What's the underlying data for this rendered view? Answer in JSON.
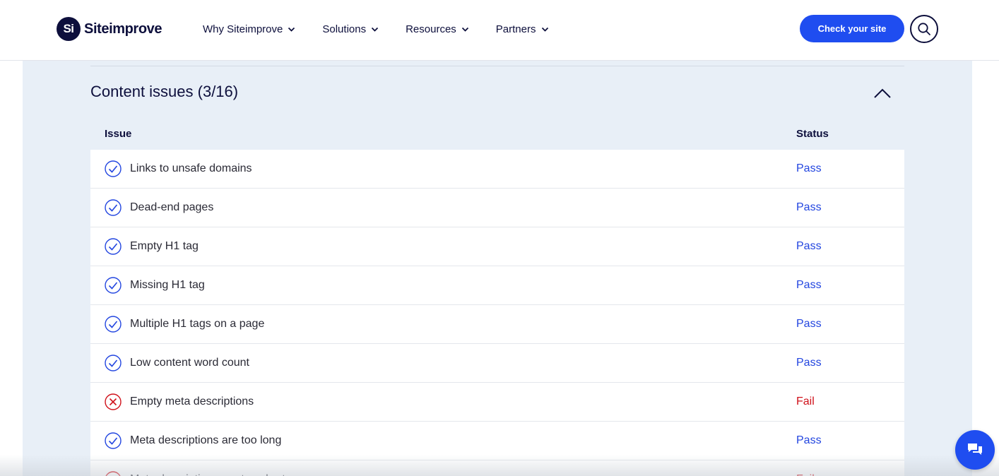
{
  "header": {
    "logo_mark": "Si",
    "logo_text": "Siteimprove",
    "nav": [
      {
        "label": "Why Siteimprove"
      },
      {
        "label": "Solutions"
      },
      {
        "label": "Resources"
      },
      {
        "label": "Partners"
      }
    ],
    "cta_label": "Check your site",
    "search_icon": "search-icon"
  },
  "section": {
    "title": "Content issues (3/16)",
    "collapse_icon": "chevron-up-icon",
    "columns": {
      "issue": "Issue",
      "status": "Status"
    },
    "rows": [
      {
        "issue": "Links to unsafe domains",
        "status": "Pass",
        "result": "pass"
      },
      {
        "issue": "Dead-end pages",
        "status": "Pass",
        "result": "pass"
      },
      {
        "issue": "Empty H1 tag",
        "status": "Pass",
        "result": "pass"
      },
      {
        "issue": "Missing H1 tag",
        "status": "Pass",
        "result": "pass"
      },
      {
        "issue": "Multiple H1 tags on a page",
        "status": "Pass",
        "result": "pass"
      },
      {
        "issue": "Low content word count",
        "status": "Pass",
        "result": "pass"
      },
      {
        "issue": "Empty meta descriptions",
        "status": "Fail",
        "result": "fail"
      },
      {
        "issue": "Meta descriptions are too long",
        "status": "Pass",
        "result": "pass"
      },
      {
        "issue": "Meta descriptions are too short",
        "status": "Fail",
        "result": "fail"
      }
    ]
  },
  "chat": {
    "icon": "chat-icon"
  },
  "colors": {
    "brand_dark": "#0d0f3c",
    "accent": "#1f4df0",
    "pass": "#2346e0",
    "fail": "#d0121b",
    "panel_bg": "#e8eff7"
  }
}
